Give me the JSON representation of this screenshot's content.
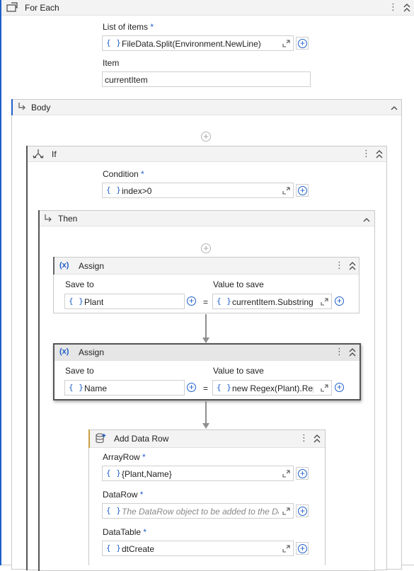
{
  "foreach": {
    "title": "For Each",
    "list_label": "List of items",
    "list_value": "FileData.Split(Environment.NewLine)",
    "item_label": "Item",
    "item_value": "currentItem"
  },
  "body": {
    "title": "Body"
  },
  "if": {
    "title": "If",
    "condition_label": "Condition",
    "condition_value": "index>0"
  },
  "then": {
    "title": "Then"
  },
  "assign1": {
    "title": "Assign",
    "save_to_label": "Save to",
    "save_to_value": "Plant",
    "value_label": "Value to save",
    "value_value": "currentItem.Substring("
  },
  "assign2": {
    "title": "Assign",
    "save_to_label": "Save to",
    "save_to_value": "Name",
    "value_label": "Value to save",
    "value_value": "new Regex(Plant).Repl"
  },
  "adddatarow": {
    "title": "Add Data Row",
    "arrayrow_label": "ArrayRow",
    "arrayrow_value": "{Plant,Name}",
    "datarow_label": "DataRow",
    "datarow_placeholder": "The DataRow object to be added to the Da",
    "datatable_label": "DataTable",
    "datatable_value": "dtCreate"
  },
  "common": {
    "required_mark": "*",
    "braces": "{ }",
    "equals": "=",
    "kebab": "⋮"
  },
  "colors": {
    "accent": "#1f5fc9",
    "header_bg": "#f3f3f3",
    "selected_header_bg": "#e6e6e6",
    "border": "#c9c9c9"
  },
  "icons": [
    "foreach-icon",
    "body-arrow-icon",
    "if-icon",
    "then-arrow-icon",
    "assign-icon",
    "add-data-row-icon",
    "kebab-menu-icon",
    "collapse-chevron-icon",
    "expand-editor-icon",
    "add-circle-icon"
  ]
}
